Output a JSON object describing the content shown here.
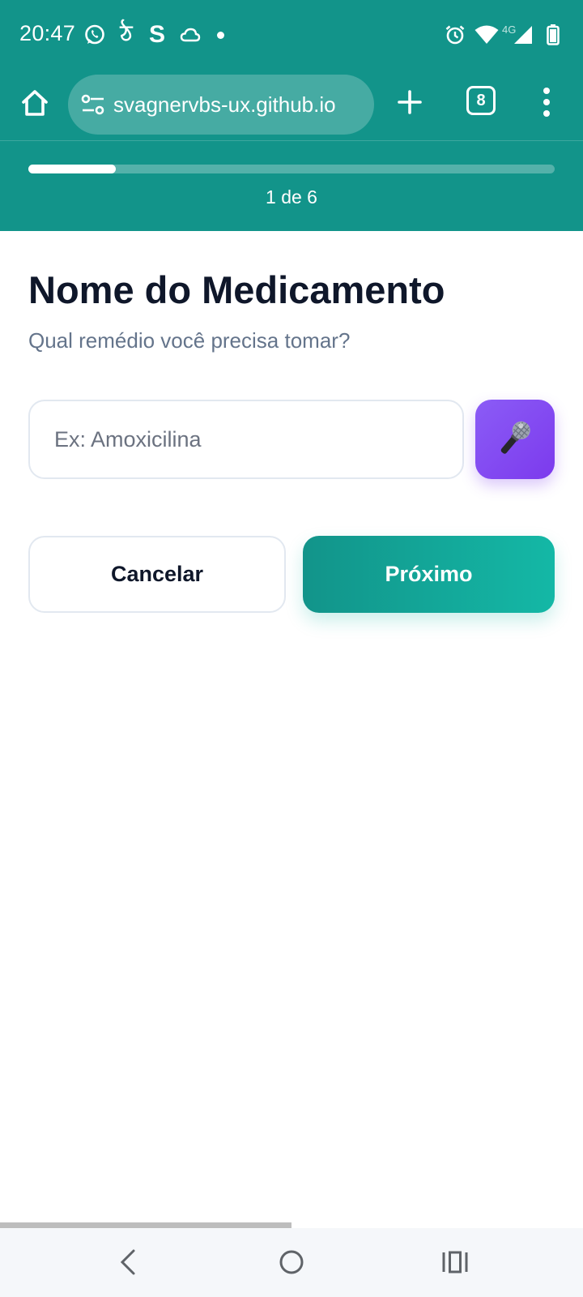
{
  "status_bar": {
    "time": "20:47",
    "left_icons": [
      "whatsapp-icon",
      "hook-app-icon",
      "s-app-icon",
      "cloud-icon",
      "notification-dot-icon"
    ],
    "hook_glyph": "ঠ",
    "s_glyph": "S",
    "network_label": "4G",
    "right_icons": [
      "alarm-icon",
      "wifi-icon",
      "signal-icon",
      "battery-icon"
    ]
  },
  "browser": {
    "url": "svagnervbs-ux.github.io",
    "tab_count": "8",
    "icons": [
      "home-icon",
      "tune-icon",
      "plus-icon",
      "more-vert-icon"
    ]
  },
  "progress": {
    "label": "1 de 6",
    "fraction": 0.1667
  },
  "form": {
    "title": "Nome do Medicamento",
    "subtitle": "Qual remédio você precisa tomar?",
    "input_value": "",
    "input_placeholder": "Ex: Amoxicilina",
    "mic_icon": "microphone-icon",
    "cancel_label": "Cancelar",
    "next_label": "Próximo"
  },
  "colors": {
    "header": "#12948a",
    "title": "#0f172a",
    "subtitle": "#64748b",
    "mic_button": "#8b5cf6",
    "next_button": "#14b8a6"
  },
  "nav_bar": {
    "icons": [
      "back-icon",
      "home-circle-icon",
      "recents-icon"
    ]
  }
}
